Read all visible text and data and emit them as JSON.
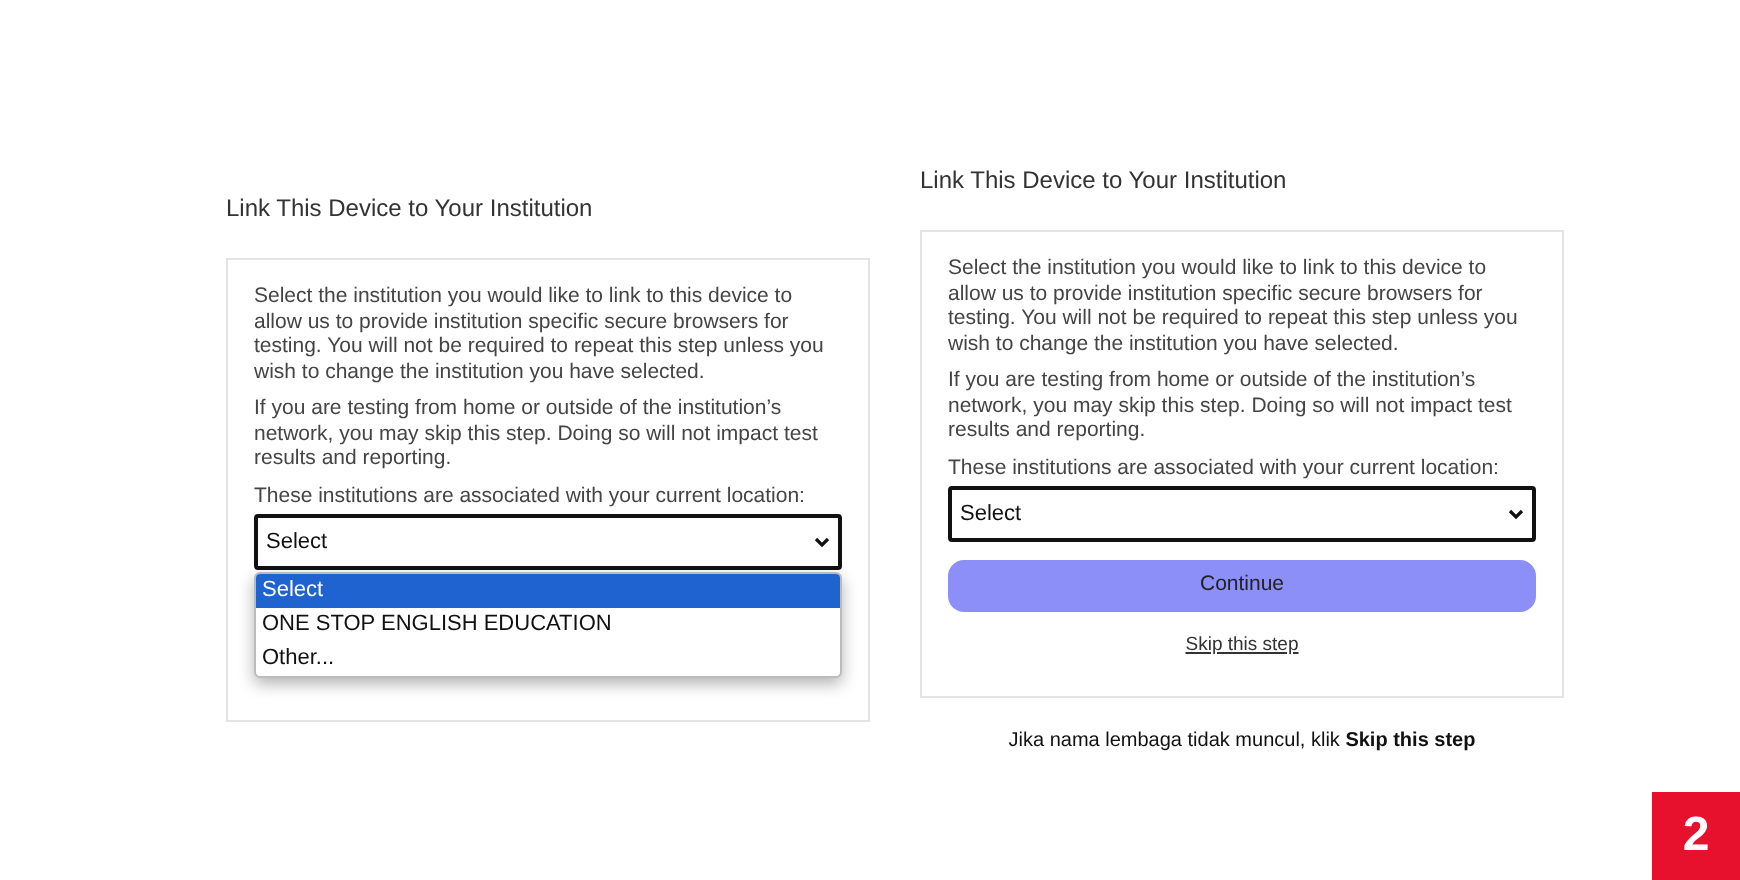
{
  "panels": [
    {
      "heading": "Link This Device to Your Institution",
      "paragraphs": [
        "Select the institution you would like to link to this device to allow us to provide institution specific secure browsers for testing. You will not be required to repeat this step unless you wish to change the institution you have selected.",
        "If you are testing from home or outside of the institution’s network, you may skip this step. Doing so will not impact test results and reporting."
      ],
      "location_label": "These institutions are associated with your current location:",
      "select": {
        "value": "Select",
        "options": [
          {
            "label": "Select",
            "selected": true
          },
          {
            "label": "ONE STOP ENGLISH EDUCATION",
            "selected": false
          },
          {
            "label": "Other...",
            "selected": false
          }
        ]
      }
    },
    {
      "heading": "Link This Device to Your Institution",
      "paragraphs": [
        "Select the institution you would like to link to this device to allow us to provide institution specific secure browsers for testing. You will not be required to repeat this step unless you wish to change the institution you have selected.",
        "If you are testing from home or outside of the institution’s network, you may skip this step. Doing so will not impact test results and reporting."
      ],
      "location_label": "These institutions are associated with your current location:",
      "select": {
        "value": "Select"
      },
      "continue_button": "Continue",
      "skip_link": "Skip this step",
      "caption": "Jika nama lembaga tidak muncul, klik **Skip this step**"
    }
  ],
  "step_badge": "2"
}
